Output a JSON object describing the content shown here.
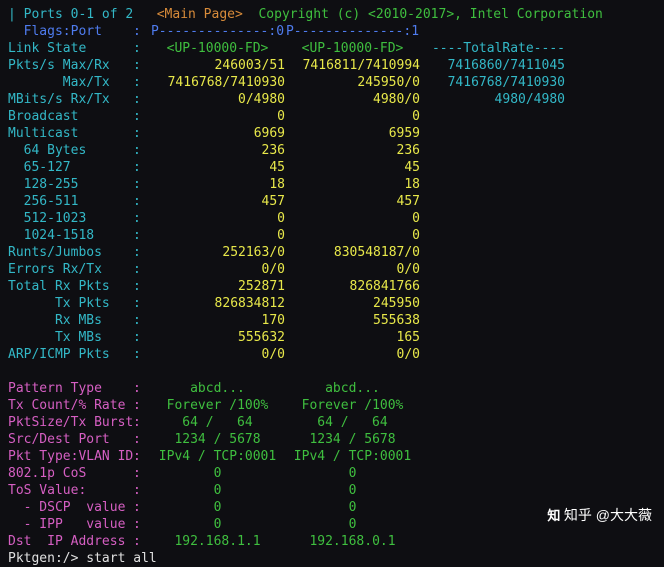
{
  "header": {
    "ports": "Ports 0-1 of 2",
    "main_page": "<Main Page>",
    "copyright_left": "Copyright (c) <",
    "copyright_years": "2010-2017",
    "copyright_right": ">, Intel Corporation"
  },
  "flags_row": {
    "label": "  Flags:Port",
    "sep": ":",
    "p0": "P--------------:0",
    "p1": "P--------------:1"
  },
  "stat_rows": [
    {
      "label": "Link State",
      "p0": "<UP-10000-FD>",
      "p1": "<UP-10000-FD>",
      "tot": "----TotalRate----",
      "cls": "green",
      "center": true,
      "totcls": "cyan"
    },
    {
      "label": "Pkts/s Max/Rx",
      "p0": "246003/51",
      "p1": "7416811/7410994",
      "tot": "7416860/7411045",
      "cls": "yellow",
      "totcls": "cyan"
    },
    {
      "label": "       Max/Tx",
      "p0": "7416768/7410930",
      "p1": "245950/0",
      "tot": "7416768/7410930",
      "cls": "yellow",
      "totcls": "cyan"
    },
    {
      "label": "MBits/s Rx/Tx",
      "p0": "0/4980",
      "p1": "4980/0",
      "tot": "4980/4980",
      "cls": "yellow",
      "totcls": "cyan"
    },
    {
      "label": "Broadcast",
      "p0": "0",
      "p1": "0",
      "cls": "yellow"
    },
    {
      "label": "Multicast",
      "p0": "6969",
      "p1": "6959",
      "cls": "yellow"
    },
    {
      "label": "  64 Bytes",
      "p0": "236",
      "p1": "236",
      "cls": "yellow"
    },
    {
      "label": "  65-127",
      "p0": "45",
      "p1": "45",
      "cls": "yellow"
    },
    {
      "label": "  128-255",
      "p0": "18",
      "p1": "18",
      "cls": "yellow"
    },
    {
      "label": "  256-511",
      "p0": "457",
      "p1": "457",
      "cls": "yellow"
    },
    {
      "label": "  512-1023",
      "p0": "0",
      "p1": "0",
      "cls": "yellow"
    },
    {
      "label": "  1024-1518",
      "p0": "0",
      "p1": "0",
      "cls": "yellow"
    },
    {
      "label": "Runts/Jumbos",
      "p0": "252163/0",
      "p1": "830548187/0",
      "cls": "yellow"
    },
    {
      "label": "Errors Rx/Tx",
      "p0": "0/0",
      "p1": "0/0",
      "cls": "yellow"
    },
    {
      "label": "Total Rx Pkts",
      "p0": "252871",
      "p1": "826841766",
      "cls": "yellow"
    },
    {
      "label": "      Tx Pkts",
      "p0": "826834812",
      "p1": "245950",
      "cls": "yellow"
    },
    {
      "label": "      Rx MBs",
      "p0": "170",
      "p1": "555638",
      "cls": "yellow"
    },
    {
      "label": "      Tx MBs",
      "p0": "555632",
      "p1": "165",
      "cls": "yellow"
    },
    {
      "label": "ARP/ICMP Pkts",
      "p0": "0/0",
      "p1": "0/0",
      "cls": "yellow"
    }
  ],
  "cfg_rows": [
    {
      "label": "Pattern Type",
      "p0": "abcd...",
      "p1": "abcd...",
      "cls": "green",
      "center": true
    },
    {
      "label": "Tx Count/% Rate",
      "p0": "Forever /100%",
      "p1": "Forever /100%",
      "cls": "green",
      "center": true
    },
    {
      "label": "PktSize/Tx Burst",
      "p0": "64 /   64",
      "p1": "64 /   64",
      "cls": "green",
      "center": true
    },
    {
      "label": "Src/Dest Port",
      "p0": "1234 / 5678",
      "p1": "1234 / 5678",
      "cls": "green",
      "center": true
    },
    {
      "label": "Pkt Type:VLAN ID",
      "p0": "IPv4 / TCP:0001",
      "p1": "IPv4 / TCP:0001",
      "cls": "green",
      "center": true
    },
    {
      "label": "802.1p CoS",
      "p0": "0",
      "p1": "0",
      "cls": "green",
      "center": true
    },
    {
      "label": "ToS Value:",
      "p0": "0",
      "p1": "0",
      "cls": "green",
      "center": true
    },
    {
      "label": "  - DSCP  value",
      "p0": "0",
      "p1": "0",
      "cls": "green",
      "center": true
    },
    {
      "label": "  - IPP   value",
      "p0": "0",
      "p1": "0",
      "cls": "green",
      "center": true
    },
    {
      "label": "Dst  IP Address",
      "p0": "192.168.1.1",
      "p1": "192.168.0.1",
      "cls": "green",
      "center": true
    }
  ],
  "prompt": {
    "label": "Pktgen:/>",
    "cmd": " start all"
  },
  "watermark": "知乎 @大大薇"
}
